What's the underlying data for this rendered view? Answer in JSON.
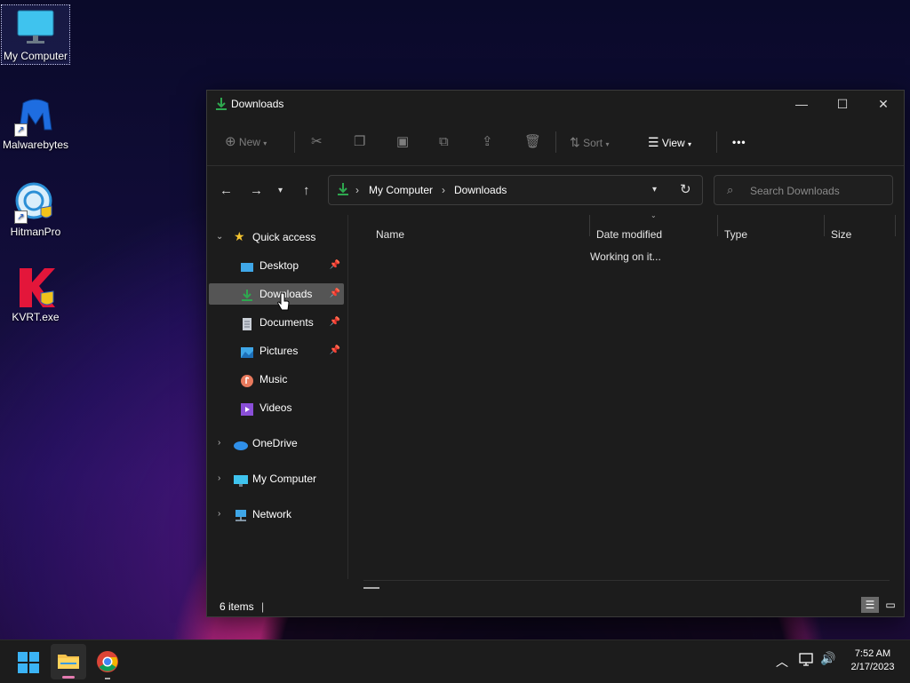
{
  "desktop": {
    "icons": [
      {
        "label": "My Computer",
        "icon": "monitor-icon"
      },
      {
        "label": "Malwarebytes",
        "icon": "malwarebytes-icon"
      },
      {
        "label": "HitmanPro",
        "icon": "hitmanpro-icon"
      },
      {
        "label": "KVRT.exe",
        "icon": "kvrt-icon"
      }
    ]
  },
  "window": {
    "title": "Downloads",
    "toolbar": {
      "new": "New",
      "sort": "Sort",
      "view": "View",
      "more": "•••"
    },
    "address": {
      "crumbs": [
        "My Computer",
        "Downloads"
      ]
    },
    "search": {
      "placeholder": "Search Downloads"
    },
    "sidebar": {
      "quick_access": "Quick access",
      "items": [
        {
          "label": "Desktop",
          "icon": "desktop-folder-icon",
          "pinned": true
        },
        {
          "label": "Downloads",
          "icon": "download-icon",
          "pinned": true,
          "selected": true
        },
        {
          "label": "Documents",
          "icon": "document-icon",
          "pinned": true
        },
        {
          "label": "Pictures",
          "icon": "picture-icon",
          "pinned": true
        },
        {
          "label": "Music",
          "icon": "music-icon"
        },
        {
          "label": "Videos",
          "icon": "video-icon"
        }
      ],
      "onedrive": "OneDrive",
      "my_computer": "My Computer",
      "network": "Network"
    },
    "columns": [
      "Name",
      "Date modified",
      "Type",
      "Size"
    ],
    "working_text": "Working on it...",
    "status": "6 items"
  },
  "taskbar": {
    "time": "7:52 AM",
    "date": "2/17/2023"
  },
  "colors": {
    "accent": "#2ea84f",
    "selection": "#555555",
    "window_bg": "#1c1c1c"
  }
}
